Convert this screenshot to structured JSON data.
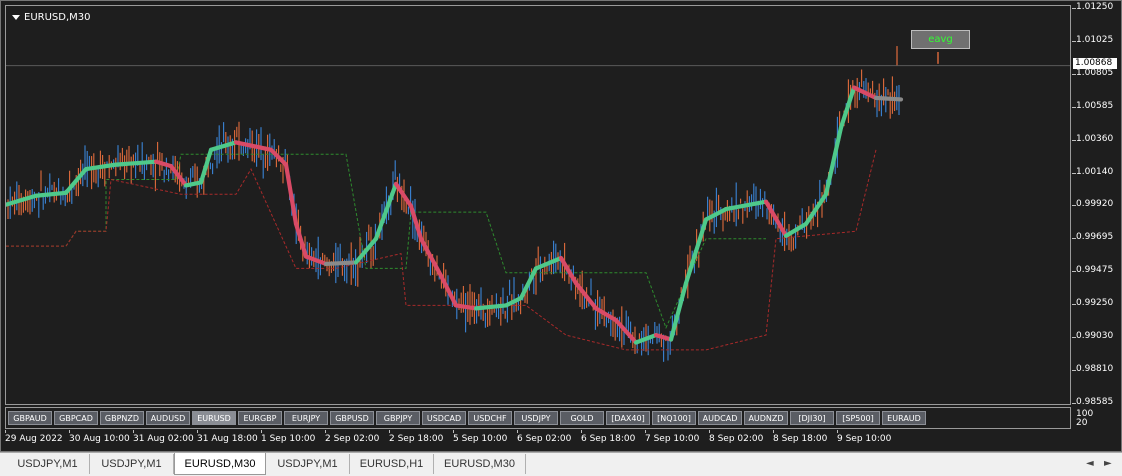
{
  "chart": {
    "title": "EURUSD,M30",
    "indicator_button": "eavg",
    "current_price": "1.00868",
    "price_labels": [
      "1.01250",
      "1.01025",
      "1.00805",
      "1.00585",
      "1.00360",
      "1.00140",
      "0.99920",
      "0.99695",
      "0.99475",
      "0.99250",
      "0.99030",
      "0.98810",
      "0.98585"
    ],
    "sub_axis_top": "100",
    "sub_axis_bottom": "20",
    "time_labels": [
      "29 Aug 2022",
      "30 Aug 10:00",
      "31 Aug 02:00",
      "31 Aug 18:00",
      "1 Sep 10:00",
      "2 Sep 02:00",
      "2 Sep 18:00",
      "5 Sep 10:00",
      "6 Sep 02:00",
      "6 Sep 18:00",
      "7 Sep 10:00",
      "8 Sep 02:00",
      "8 Sep 18:00",
      "9 Sep 10:00"
    ],
    "colors": {
      "background": "#1e1e1e",
      "bull": "#3a84d6",
      "bear": "#e06b3c",
      "ma_up": "#4ec98a",
      "ma_down": "#d94a66",
      "ma_flat": "#8a8a8a",
      "channel_up": "#2e8b2e",
      "channel_down": "#a82a2a"
    }
  },
  "symbols": [
    "GBPAUD",
    "GBPCAD",
    "GBPNZD",
    "AUDUSD",
    "EURUSD",
    "EURGBP",
    "EURJPY",
    "GBPUSD",
    "GBPJPY",
    "USDCAD",
    "USDCHF",
    "USDJPY",
    "GOLD",
    "[DAX40]",
    "[NQ100]",
    "AUDCAD",
    "AUDNZD",
    "[DJI30]",
    "[SP500]",
    "EURAUD"
  ],
  "active_symbol": "EURUSD",
  "tabs": [
    "USDJPY,M1",
    "USDJPY,M1",
    "EURUSD,M30",
    "USDJPY,M1",
    "EURUSD,H1",
    "EURUSD,M30"
  ],
  "active_tab": "EURUSD,M30",
  "tab_nav": {
    "left": "◄",
    "right": "►"
  }
}
